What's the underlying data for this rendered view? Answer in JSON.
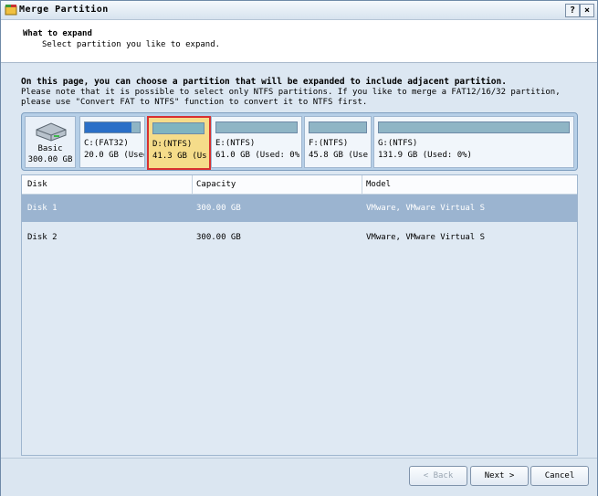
{
  "window": {
    "title": "Merge Partition",
    "help_label": "?",
    "close_label": "×"
  },
  "header": {
    "title": "What to expand",
    "subtitle": "Select partition you like to expand."
  },
  "intro": {
    "line1": "On this page, you can choose a partition that will be expanded to include adjacent partition.",
    "line2": "Please note that it is possible to select only NTFS partitions. If you like to merge a FAT12/16/32 partition,",
    "line3": "please use \"Convert FAT to NTFS\" function to convert it to NTFS first."
  },
  "disk_map": {
    "disk": {
      "type": "Basic",
      "size": "300.00 GB",
      "icon": "hard-disk-icon"
    },
    "partitions": [
      {
        "name": "C:(FAT32)",
        "info": "20.0 GB (Used:",
        "used_fraction": 0.85
      },
      {
        "name": "D:(NTFS)",
        "info": "41.3 GB (Us",
        "used_fraction": 0.0,
        "selected": true
      },
      {
        "name": "E:(NTFS)",
        "info": "61.0 GB (Used: 0%",
        "used_fraction": 0.0
      },
      {
        "name": "F:(NTFS)",
        "info": "45.8 GB (Use",
        "used_fraction": 0.0
      },
      {
        "name": "G:(NTFS)",
        "info": "131.9 GB (Used: 0%)",
        "used_fraction": 0.0
      }
    ]
  },
  "table": {
    "columns": [
      "Disk",
      "Capacity",
      "Model"
    ],
    "rows": [
      {
        "disk": "Disk 1",
        "capacity": "300.00 GB",
        "model": "VMware, VMware Virtual S",
        "selected": true
      },
      {
        "disk": "Disk 2",
        "capacity": "300.00 GB",
        "model": "VMware, VMware Virtual S",
        "selected": false
      }
    ]
  },
  "buttons": {
    "back": "< Back",
    "next": "Next >",
    "cancel": "Cancel"
  },
  "colors": {
    "selected_border": "#d83030",
    "selected_fill": "#f5dc8a",
    "used_bar": "#2a6fc7",
    "row_selected": "#9bb4d0"
  }
}
